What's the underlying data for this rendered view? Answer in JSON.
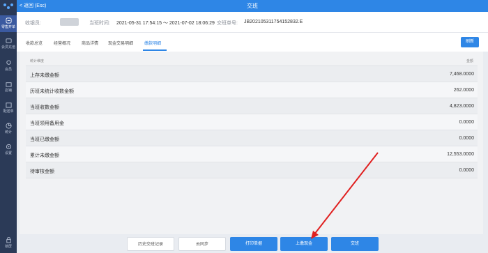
{
  "header": {
    "back_label": "< 返回 (Esc)",
    "title": "交班"
  },
  "sidebar": {
    "items": [
      {
        "label": "零售开单",
        "icon": "cashier-icon"
      },
      {
        "label": "会员充值",
        "icon": "recharge-icon"
      },
      {
        "label": "会员",
        "icon": "member-icon"
      },
      {
        "label": "店铺",
        "icon": "shop-icon"
      },
      {
        "label": "配送单",
        "icon": "delivery-icon"
      },
      {
        "label": "统计",
        "icon": "stats-icon"
      },
      {
        "label": "设置",
        "icon": "settings-icon"
      },
      {
        "label": "锁屏",
        "icon": "lock-icon"
      }
    ]
  },
  "info": {
    "cashier_label": "收银员:",
    "shift_time_label": "当班时间:",
    "shift_time_value": "2021-05-31 17:54:15 ～ 2021-07-02 18:06:29",
    "order_no_label": "交班单号:",
    "order_no_value": "JB202105311754152832.E"
  },
  "tabs": [
    "收款总览",
    "经营概况",
    "商品详情",
    "现金交易明细",
    "缴款明细"
  ],
  "refresh_label": "刷新",
  "table": {
    "col_dimension": "统计维度",
    "col_amount": "金额",
    "rows": [
      {
        "label": "上存未缴金额",
        "value": "7,468.0000"
      },
      {
        "label": "历班未统计收数金额",
        "value": "262.0000"
      },
      {
        "label": "当班收数金额",
        "value": "4,823.0000"
      },
      {
        "label": "当班领用备用金",
        "value": "0.0000"
      },
      {
        "label": "当班已缴金额",
        "value": "0.0000"
      },
      {
        "label": "累计未缴金额",
        "value": "12,553.0000"
      },
      {
        "label": "待审核金额",
        "value": "0.0000"
      }
    ]
  },
  "buttons": {
    "history": "历史交班记录",
    "sync": "云同步",
    "print": "打印单据",
    "submit_cash": "上缴现金",
    "handover": "交班"
  },
  "colors": {
    "primary": "#2e86e6",
    "sidebar": "#2b3a57",
    "arrow": "#e02020"
  }
}
